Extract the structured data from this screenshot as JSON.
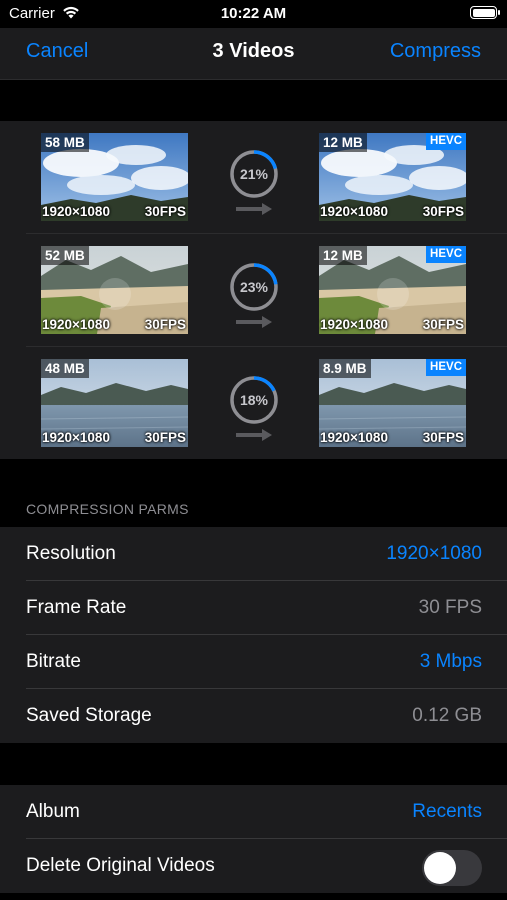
{
  "status_bar": {
    "carrier": "Carrier",
    "time": "10:22 AM"
  },
  "nav": {
    "cancel_label": "Cancel",
    "title": "3 Videos",
    "compress_label": "Compress"
  },
  "videos": [
    {
      "source_size": "58 MB",
      "output_size": "12 MB",
      "resolution": "1920×1080",
      "fps": "30FPS",
      "codec_badge": "HEVC",
      "progress_label": "21%",
      "progress": 0.21,
      "scene": "sky-clouds"
    },
    {
      "source_size": "52 MB",
      "output_size": "12 MB",
      "resolution": "1920×1080",
      "fps": "30FPS",
      "codec_badge": "HEVC",
      "progress_label": "23%",
      "progress": 0.23,
      "scene": "beach-mountains"
    },
    {
      "source_size": "48 MB",
      "output_size": "8.9 MB",
      "resolution": "1920×1080",
      "fps": "30FPS",
      "codec_badge": "HEVC",
      "progress_label": "18%",
      "progress": 0.18,
      "scene": "lake-mountains"
    }
  ],
  "compression_section": {
    "header": "COMPRESSION PARMS",
    "rows": [
      {
        "label": "Resolution",
        "value": "1920×1080"
      },
      {
        "label": "Frame Rate",
        "value": "30 FPS"
      },
      {
        "label": "Bitrate",
        "value": "3 Mbps"
      },
      {
        "label": "Saved Storage",
        "value": "0.12 GB"
      }
    ]
  },
  "options": {
    "album_label": "Album",
    "album_value": "Recents",
    "delete_label": "Delete Original Videos",
    "delete_enabled": false
  },
  "colors": {
    "accent": "#0a84ff",
    "background": "#000000",
    "cell": "#1c1c1e",
    "secondary_text": "#8e8e93"
  },
  "icons": [
    "wifi-icon",
    "battery-icon",
    "progress-ring-icon",
    "right-arrow-icon"
  ]
}
